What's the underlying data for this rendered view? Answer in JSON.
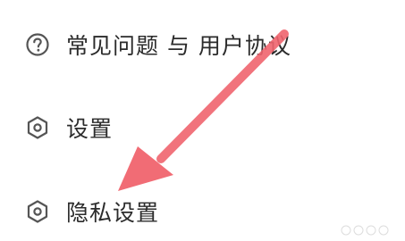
{
  "menu": {
    "items": [
      {
        "label": "常见问题 与 用户协议",
        "icon": "help-circle-icon"
      },
      {
        "label": "设置",
        "icon": "hexagon-gear-icon"
      },
      {
        "label": "隐私设置",
        "icon": "hexagon-gear-icon"
      }
    ]
  },
  "annotation": {
    "arrow_color": "#f0646e",
    "direction": "points to privacy settings"
  },
  "colors": {
    "text": "#2b2b2b",
    "icon": "#555555",
    "background": "#ffffff"
  }
}
